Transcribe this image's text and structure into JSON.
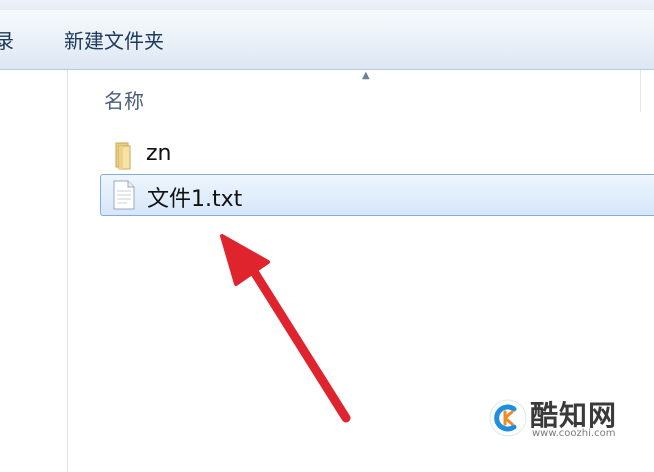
{
  "toolbar": {
    "left_partial_label": "录",
    "new_folder_label": "新建文件夹"
  },
  "file_list": {
    "column_header": "名称",
    "items": [
      {
        "name": "zn",
        "type": "folder",
        "icon": "folder-icon",
        "selected": false
      },
      {
        "name": "文件1.txt",
        "type": "text-file",
        "icon": "text-file-icon",
        "selected": true
      }
    ]
  },
  "annotation": {
    "icon": "red-arrow-icon",
    "color": "#e0242d"
  },
  "watermark": {
    "name": "酷知网",
    "url": "www.coozhi.com",
    "icon": "coozhi-logo-icon",
    "accent_color": "#1e8fe0"
  },
  "colors": {
    "toolbar_text": "#1e395b",
    "selection_border": "#84acdd"
  }
}
